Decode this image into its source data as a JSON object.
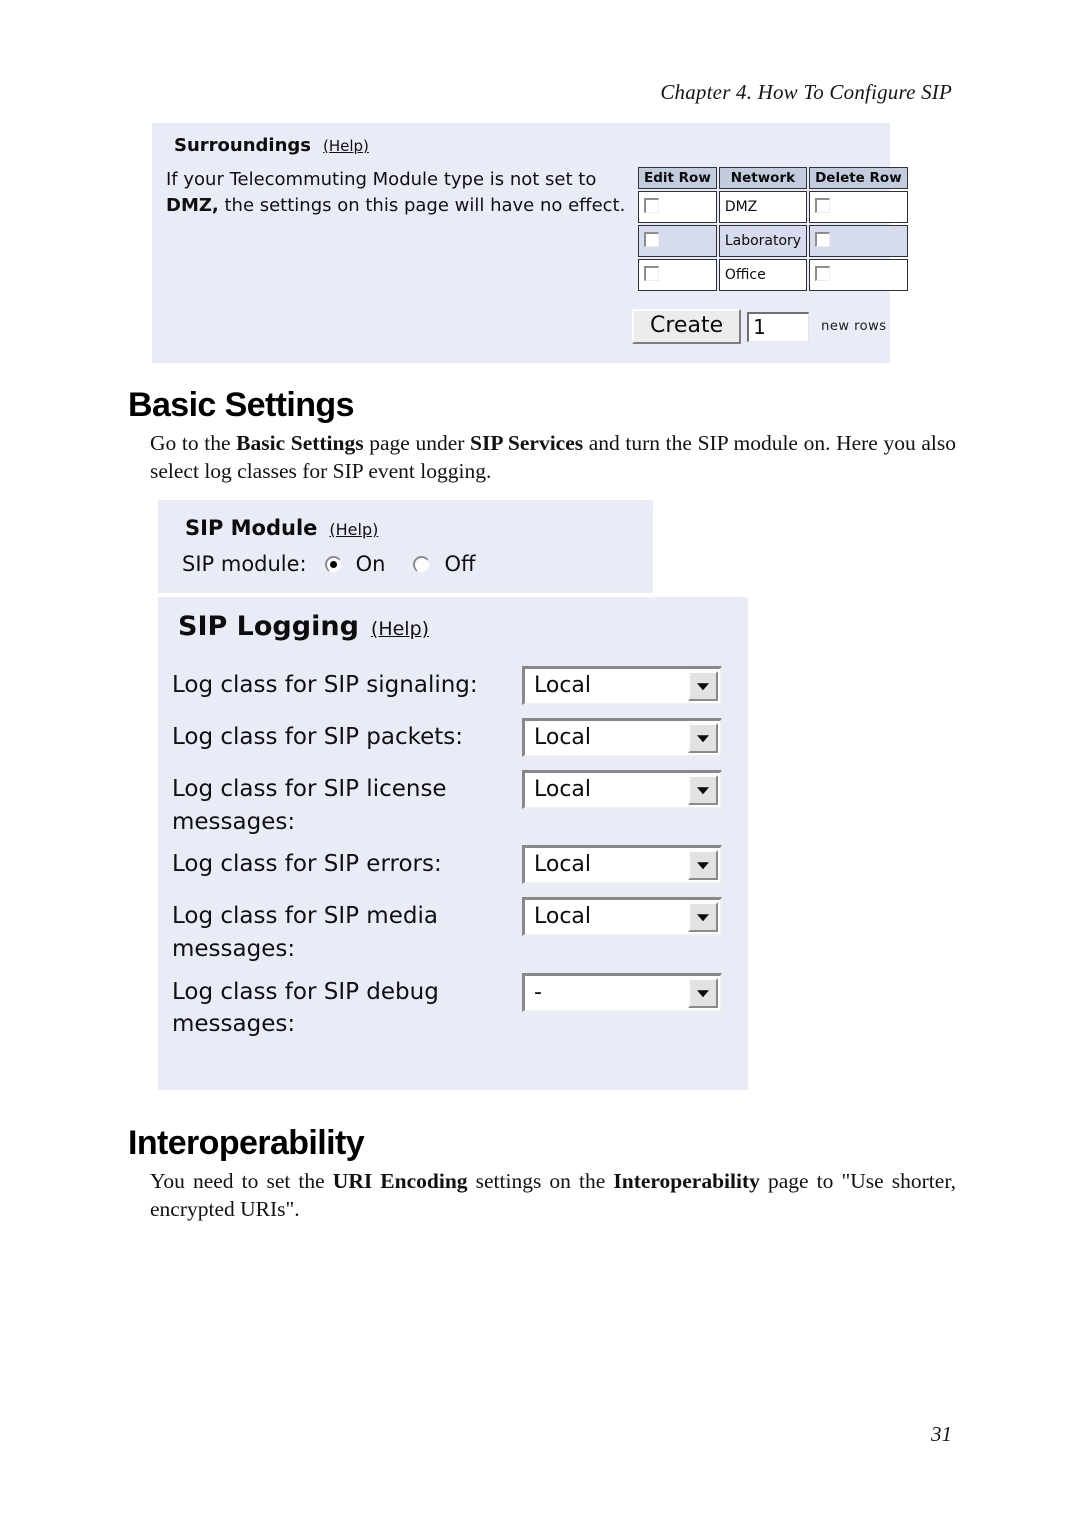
{
  "running_head": "Chapter 4. How To Configure SIP",
  "page_number": "31",
  "surroundings_panel": {
    "title": "Surroundings",
    "help_label": "(Help)",
    "note_prefix": "If your Telecommuting Module type is not set to ",
    "note_bold": "DMZ,",
    "note_suffix": " the settings on this page will have no effect.",
    "table": {
      "headers": [
        "Edit Row",
        "Network",
        "Delete Row"
      ],
      "rows": [
        {
          "edit_checked": false,
          "network": "DMZ",
          "delete_checked": false
        },
        {
          "edit_checked": false,
          "network": "Laboratory",
          "delete_checked": false
        },
        {
          "edit_checked": false,
          "network": "Office",
          "delete_checked": false
        }
      ]
    },
    "create_button_label": "Create",
    "create_count_value": "1",
    "create_suffix_label": "new rows"
  },
  "basic_settings": {
    "heading": "Basic Settings",
    "para_1": "Go to the ",
    "para_b1": "Basic Settings",
    "para_2": " page under ",
    "para_b2": "SIP Services",
    "para_3": " and turn the SIP module on. Here you also select log classes for SIP event logging."
  },
  "sip_module_panel": {
    "title": "SIP Module",
    "help_label": "(Help)",
    "field_label": "SIP module:",
    "option_on_label": "On",
    "option_off_label": "Off",
    "selected": "On"
  },
  "sip_logging_panel": {
    "title": "SIP Logging",
    "help_label": "(Help)",
    "rows": [
      {
        "label": "Log class for SIP signaling:",
        "value": "Local"
      },
      {
        "label": "Log class for SIP packets:",
        "value": "Local"
      },
      {
        "label": "Log class for SIP license messages:",
        "value": "Local"
      },
      {
        "label": "Log class for SIP errors:",
        "value": "Local"
      },
      {
        "label": "Log class for SIP media messages:",
        "value": "Local"
      },
      {
        "label": "Log class for SIP debug messages:",
        "value": "-"
      }
    ]
  },
  "interoperability": {
    "heading": "Interoperability",
    "para_1": "You need to set the ",
    "para_b1": "URI Encoding",
    "para_2": " settings on the ",
    "para_b2": "Interoperability",
    "para_3": " page to \"Use shorter, encrypted URIs\"."
  },
  "colors": {
    "panel_background": "#e9ebf7",
    "table_header_background": "#c3ccdd",
    "table_alt_row_background": "#d6dced",
    "page_background": "#ffffff"
  }
}
